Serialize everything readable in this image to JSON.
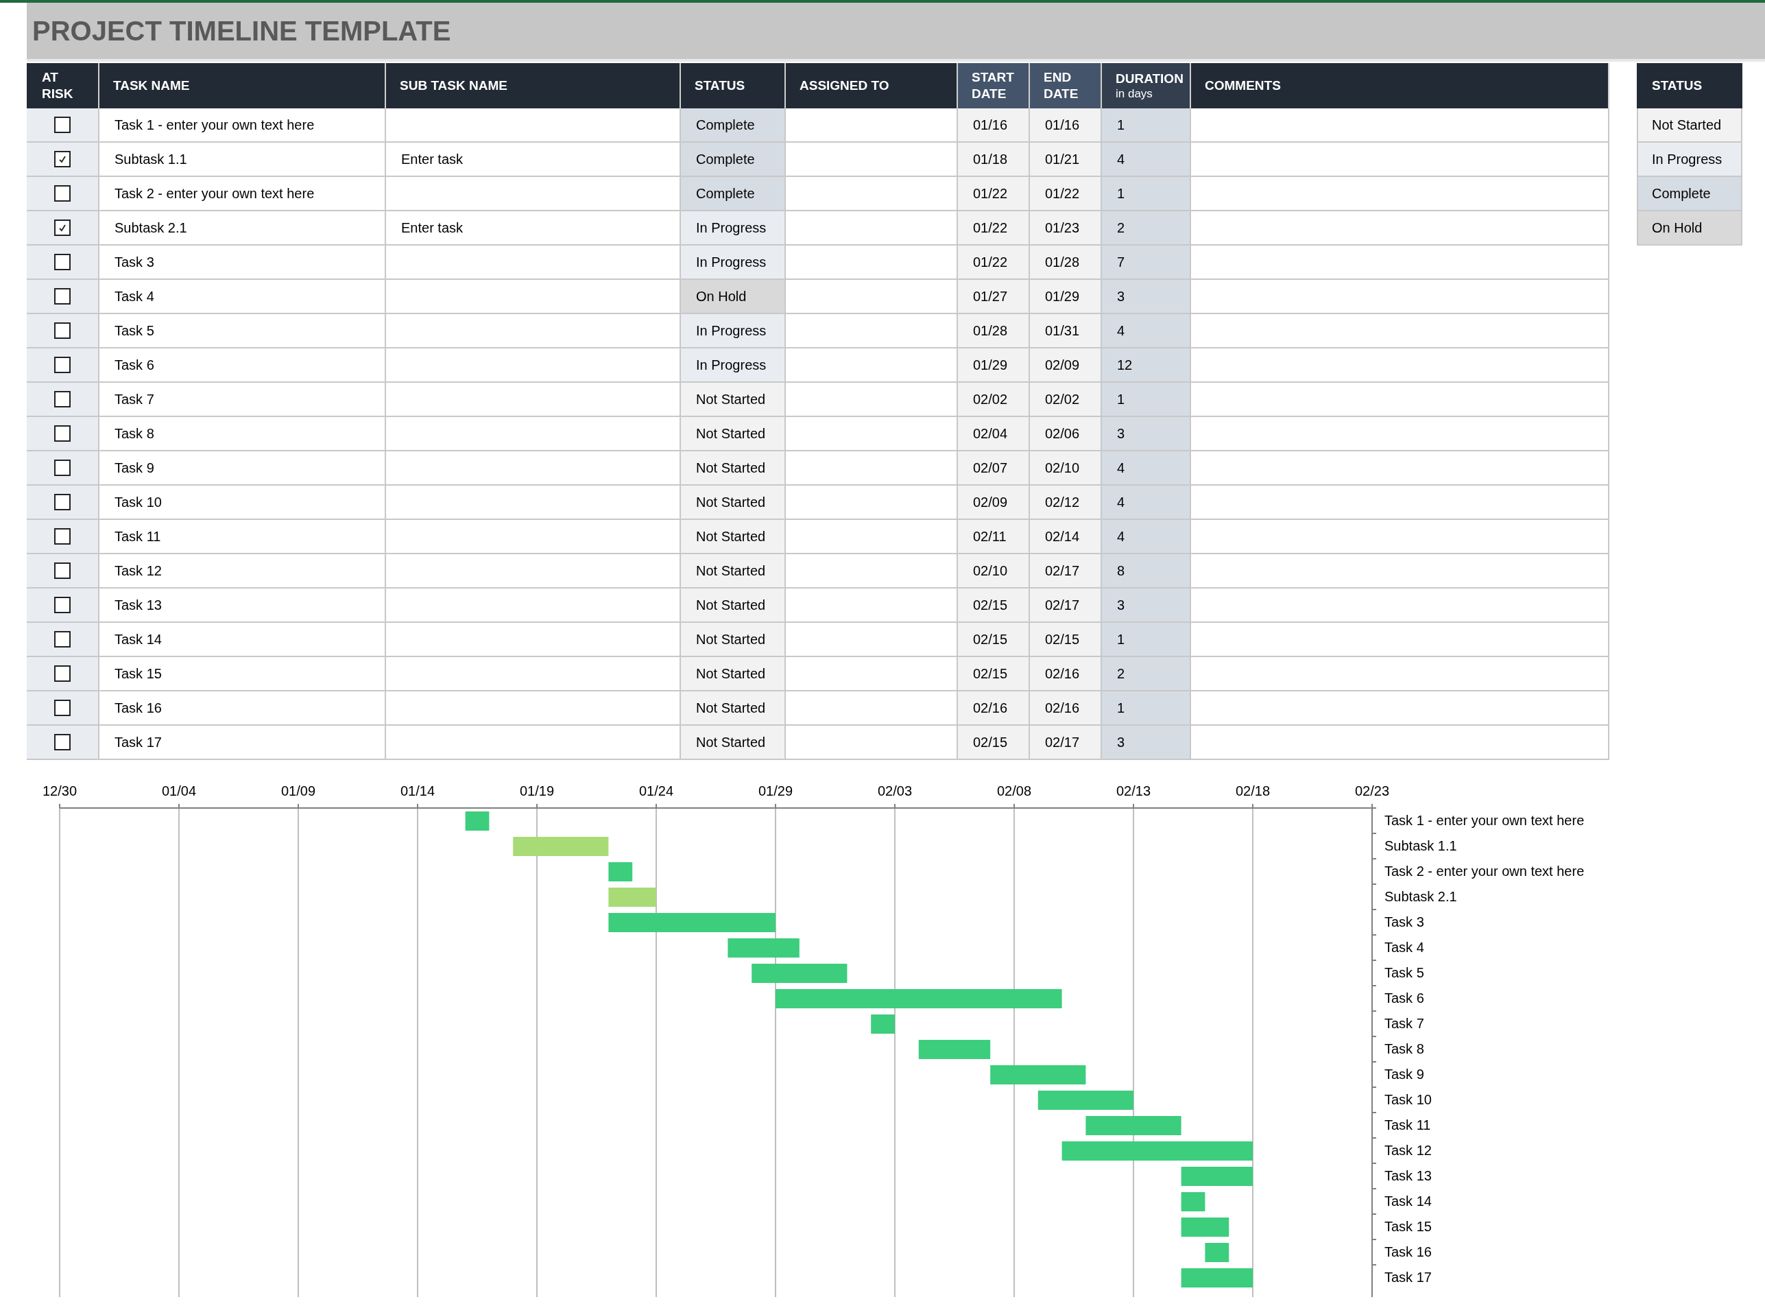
{
  "title": "PROJECT TIMELINE TEMPLATE",
  "table": {
    "columns": [
      {
        "label": "AT RISK"
      },
      {
        "label": "TASK NAME"
      },
      {
        "label": "SUB TASK NAME"
      },
      {
        "label": "STATUS"
      },
      {
        "label": "ASSIGNED TO"
      },
      {
        "label": "START DATE"
      },
      {
        "label": "END DATE"
      },
      {
        "label": "DURATION",
        "sublabel": "in days"
      },
      {
        "label": "COMMENTS"
      }
    ],
    "rows": [
      {
        "kind": "task",
        "at_risk": false,
        "task": "Task 1 - enter your own text here",
        "subtask": "",
        "status": "Complete",
        "color": "#d6dce4",
        "start": "01/16",
        "end": "01/16",
        "duration": "1"
      },
      {
        "kind": "subtask",
        "at_risk": true,
        "task": "Subtask 1.1",
        "subtask": "Enter task",
        "status": "Complete",
        "color": "#d6dce4",
        "start": "01/18",
        "end": "01/21",
        "duration": "4"
      },
      {
        "kind": "task",
        "at_risk": false,
        "task": "Task 2 - enter your own text here",
        "subtask": "",
        "status": "Complete",
        "color": "#d6dce4",
        "start": "01/22",
        "end": "01/22",
        "duration": "1"
      },
      {
        "kind": "subtask",
        "at_risk": true,
        "task": "Subtask 2.1",
        "subtask": "Enter task",
        "status": "In Progress",
        "color": "#e9edf2",
        "start": "01/22",
        "end": "01/23",
        "duration": "2"
      },
      {
        "kind": "task",
        "at_risk": false,
        "task": "Task 3",
        "subtask": "",
        "status": "In Progress",
        "color": "#e9edf2",
        "start": "01/22",
        "end": "01/28",
        "duration": "7"
      },
      {
        "kind": "task",
        "at_risk": false,
        "task": "Task 4",
        "subtask": "",
        "status": "On Hold",
        "color": "#d9d9d9",
        "start": "01/27",
        "end": "01/29",
        "duration": "3"
      },
      {
        "kind": "task",
        "at_risk": false,
        "task": "Task 5",
        "subtask": "",
        "status": "In Progress",
        "color": "#e9edf2",
        "start": "01/28",
        "end": "01/31",
        "duration": "4"
      },
      {
        "kind": "task",
        "at_risk": false,
        "task": "Task 6",
        "subtask": "",
        "status": "In Progress",
        "color": "#e9edf2",
        "start": "01/29",
        "end": "02/09",
        "duration": "12"
      },
      {
        "kind": "task",
        "at_risk": false,
        "task": "Task 7",
        "subtask": "",
        "status": "Not Started",
        "color": "#f2f2f2",
        "start": "02/02",
        "end": "02/02",
        "duration": "1"
      },
      {
        "kind": "task",
        "at_risk": false,
        "task": "Task 8",
        "subtask": "",
        "status": "Not Started",
        "color": "#f2f2f2",
        "start": "02/04",
        "end": "02/06",
        "duration": "3"
      },
      {
        "kind": "task",
        "at_risk": false,
        "task": "Task 9",
        "subtask": "",
        "status": "Not Started",
        "color": "#f2f2f2",
        "start": "02/07",
        "end": "02/10",
        "duration": "4"
      },
      {
        "kind": "task",
        "at_risk": false,
        "task": "Task 10",
        "subtask": "",
        "status": "Not Started",
        "color": "#f2f2f2",
        "start": "02/09",
        "end": "02/12",
        "duration": "4"
      },
      {
        "kind": "task",
        "at_risk": false,
        "task": "Task 11",
        "subtask": "",
        "status": "Not Started",
        "color": "#f2f2f2",
        "start": "02/11",
        "end": "02/14",
        "duration": "4"
      },
      {
        "kind": "task",
        "at_risk": false,
        "task": "Task 12",
        "subtask": "",
        "status": "Not Started",
        "color": "#f2f2f2",
        "start": "02/10",
        "end": "02/17",
        "duration": "8"
      },
      {
        "kind": "task",
        "at_risk": false,
        "task": "Task 13",
        "subtask": "",
        "status": "Not Started",
        "color": "#f2f2f2",
        "start": "02/15",
        "end": "02/17",
        "duration": "3"
      },
      {
        "kind": "task",
        "at_risk": false,
        "task": "Task 14",
        "subtask": "",
        "status": "Not Started",
        "color": "#f2f2f2",
        "start": "02/15",
        "end": "02/15",
        "duration": "1"
      },
      {
        "kind": "task",
        "at_risk": false,
        "task": "Task 15",
        "subtask": "",
        "status": "Not Started",
        "color": "#f2f2f2",
        "start": "02/15",
        "end": "02/16",
        "duration": "2"
      },
      {
        "kind": "task",
        "at_risk": false,
        "task": "Task 16",
        "subtask": "",
        "status": "Not Started",
        "color": "#f2f2f2",
        "start": "02/16",
        "end": "02/16",
        "duration": "1"
      },
      {
        "kind": "task",
        "at_risk": false,
        "task": "Task 17",
        "subtask": "",
        "status": "Not Started",
        "color": "#f2f2f2",
        "start": "02/15",
        "end": "02/17",
        "duration": "3"
      }
    ]
  },
  "status_legend": {
    "title": "STATUS",
    "items": [
      {
        "label": "Not Started",
        "color": "#f2f2f2"
      },
      {
        "label": "In Progress",
        "color": "#e9edf2"
      },
      {
        "label": "Complete",
        "color": "#d6dce4"
      },
      {
        "label": "On Hold",
        "color": "#d9d9d9"
      }
    ]
  },
  "timeline": {
    "tick_labels": [
      "12/30",
      "01/04",
      "01/09",
      "01/14",
      "01/19",
      "01/24",
      "01/29",
      "02/03",
      "02/08",
      "02/13",
      "02/18",
      "02/23"
    ],
    "task_labels": [
      "Task 1 - enter your own text here",
      "Subtask 1.1",
      "Task 2 - enter your own text here",
      "Subtask 2.1",
      "Task 3",
      "Task 4",
      "Task 5",
      "Task 6",
      "Task 7",
      "Task 8",
      "Task 9",
      "Task 10",
      "Task 11",
      "Task 12",
      "Task 13",
      "Task 14",
      "Task 15",
      "Task 16",
      "Task 17"
    ]
  }
}
